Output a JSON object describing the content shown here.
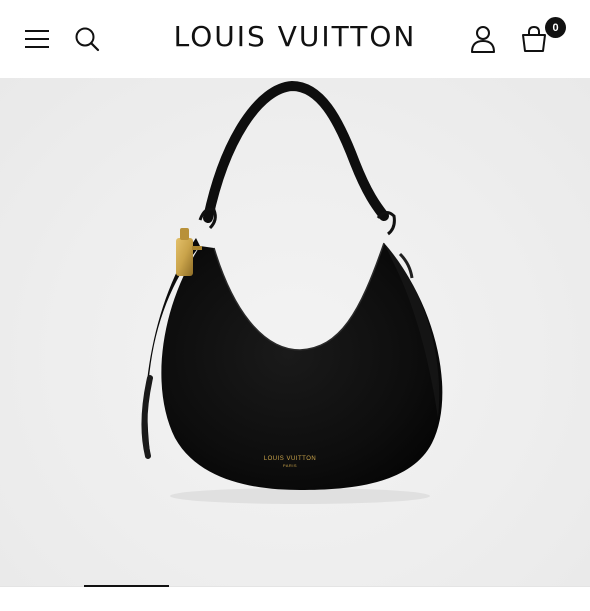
{
  "header": {
    "brand": "LOUIS VUITTON",
    "cart_count": "0",
    "menu_icon": "menu-icon",
    "search_icon": "search-icon",
    "account_icon": "account-icon",
    "cart_icon": "shopping-bag-icon"
  },
  "product": {
    "imprint_line1": "LOUIS VUITTON",
    "imprint_line2": "PARIS",
    "bag_color": "#0e0e0e",
    "hardware_color": "#c9a34a"
  },
  "gallery": {
    "active_slide": 1
  }
}
